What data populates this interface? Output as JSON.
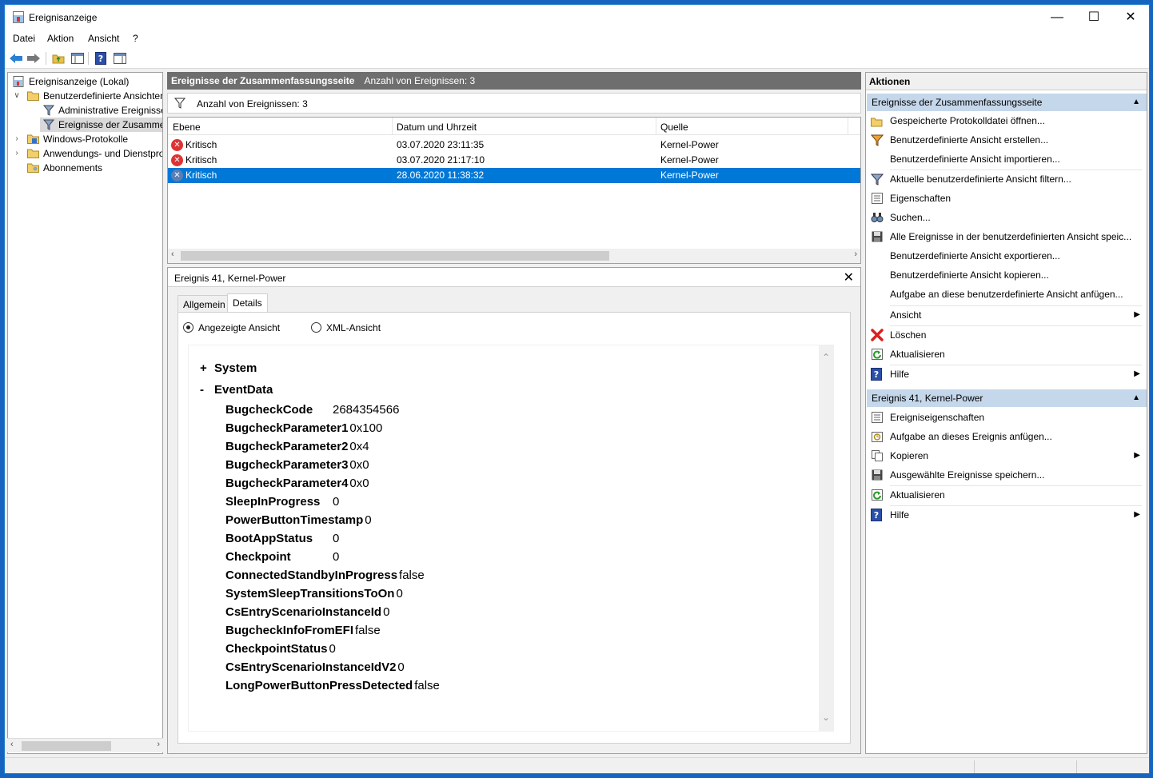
{
  "window": {
    "title": "Ereignisanzeige"
  },
  "menu": [
    "Datei",
    "Aktion",
    "Ansicht",
    "?"
  ],
  "tree": {
    "items": [
      {
        "label": "Ereignisanzeige (Lokal)",
        "level": 0,
        "expander": ""
      },
      {
        "label": "Benutzerdefinierte Ansichten",
        "level": 1,
        "expander": "∨"
      },
      {
        "label": "Administrative Ereignisse",
        "level": 2,
        "expander": ""
      },
      {
        "label": "Ereignisse der Zusammenfassungsseite",
        "level": 2,
        "expander": "",
        "selected": true
      },
      {
        "label": "Windows-Protokolle",
        "level": 1,
        "expander": "›"
      },
      {
        "label": "Anwendungs- und Dienstprotokolle",
        "level": 1,
        "expander": "›"
      },
      {
        "label": "Abonnements",
        "level": 1,
        "expander": ""
      }
    ]
  },
  "center": {
    "header_title": "Ereignisse der Zusammenfassungsseite",
    "header_count": "Anzahl von Ereignissen: 3",
    "filter_text": "Anzahl von Ereignissen: 3",
    "columns": [
      "Ebene",
      "Datum und Uhrzeit",
      "Quelle"
    ],
    "rows": [
      {
        "level": "Kritisch",
        "datetime": "03.07.2020 23:11:35",
        "source": "Kernel-Power"
      },
      {
        "level": "Kritisch",
        "datetime": "03.07.2020 21:17:10",
        "source": "Kernel-Power"
      },
      {
        "level": "Kritisch",
        "datetime": "28.06.2020 11:38:32",
        "source": "Kernel-Power",
        "selected": true
      }
    ]
  },
  "detail": {
    "title": "Ereignis 41, Kernel-Power",
    "tabs": [
      "Allgemein",
      "Details"
    ],
    "active_tab": "Details",
    "radio_friendly": "Angezeigte Ansicht",
    "radio_xml": "XML-Ansicht",
    "system_label": "System",
    "system_toggle": "+",
    "eventdata_label": "EventData",
    "eventdata_toggle": "-",
    "eventdata": [
      {
        "key": "BugcheckCode",
        "value": "2684354566"
      },
      {
        "key": "BugcheckParameter1",
        "value": "0x100"
      },
      {
        "key": "BugcheckParameter2",
        "value": "0x4"
      },
      {
        "key": "BugcheckParameter3",
        "value": "0x0"
      },
      {
        "key": "BugcheckParameter4",
        "value": "0x0"
      },
      {
        "key": "SleepInProgress",
        "value": "0"
      },
      {
        "key": "PowerButtonTimestamp",
        "value": "0"
      },
      {
        "key": "BootAppStatus",
        "value": "0"
      },
      {
        "key": "Checkpoint",
        "value": "0"
      },
      {
        "key": "ConnectedStandbyInProgress",
        "value": "false"
      },
      {
        "key": "SystemSleepTransitionsToOn",
        "value": "0"
      },
      {
        "key": "CsEntryScenarioInstanceId",
        "value": "0"
      },
      {
        "key": "BugcheckInfoFromEFI",
        "value": "false"
      },
      {
        "key": "CheckpointStatus",
        "value": "0"
      },
      {
        "key": "CsEntryScenarioInstanceIdV2",
        "value": "0"
      },
      {
        "key": "LongPowerButtonPressDetected",
        "value": "false"
      }
    ]
  },
  "actions": {
    "header": "Aktionen",
    "section1": {
      "title": "Ereignisse der Zusammenfassungsseite",
      "items": [
        {
          "label": "Gespeicherte Protokolldatei öffnen...",
          "icon": "folder-open-icon"
        },
        {
          "label": "Benutzerdefinierte Ansicht erstellen...",
          "icon": "filter-create-icon"
        },
        {
          "label": "Benutzerdefinierte Ansicht importieren...",
          "icon": ""
        },
        {
          "label": "Aktuelle benutzerdefinierte Ansicht filtern...",
          "icon": "filter-icon"
        },
        {
          "label": "Eigenschaften",
          "icon": "properties-icon"
        },
        {
          "label": "Suchen...",
          "icon": "binoculars-icon"
        },
        {
          "label": "Alle Ereignisse in der benutzerdefinierten Ansicht speic...",
          "icon": "save-icon"
        },
        {
          "label": "Benutzerdefinierte Ansicht exportieren...",
          "icon": ""
        },
        {
          "label": "Benutzerdefinierte Ansicht kopieren...",
          "icon": ""
        },
        {
          "label": "Aufgabe an diese benutzerdefinierte Ansicht anfügen...",
          "icon": ""
        },
        {
          "label": "Ansicht",
          "icon": "",
          "submenu": true
        },
        {
          "label": "Löschen",
          "icon": "delete-icon"
        },
        {
          "label": "Aktualisieren",
          "icon": "refresh-icon"
        },
        {
          "label": "Hilfe",
          "icon": "help-icon",
          "submenu": true
        }
      ]
    },
    "section2": {
      "title": "Ereignis 41, Kernel-Power",
      "items": [
        {
          "label": "Ereigniseigenschaften",
          "icon": "properties-icon"
        },
        {
          "label": "Aufgabe an dieses Ereignis anfügen...",
          "icon": "task-icon"
        },
        {
          "label": "Kopieren",
          "icon": "copy-icon",
          "submenu": true
        },
        {
          "label": "Ausgewählte Ereignisse speichern...",
          "icon": "save-icon"
        },
        {
          "label": "Aktualisieren",
          "icon": "refresh-icon"
        },
        {
          "label": "Hilfe",
          "icon": "help-icon",
          "submenu": true
        }
      ]
    }
  },
  "colors": {
    "accent": "#0078d7",
    "section_bg": "#c5d7ea",
    "header_dark": "#6e6e6e",
    "error_red": "#dd3333",
    "desktop": "#1565c0"
  }
}
